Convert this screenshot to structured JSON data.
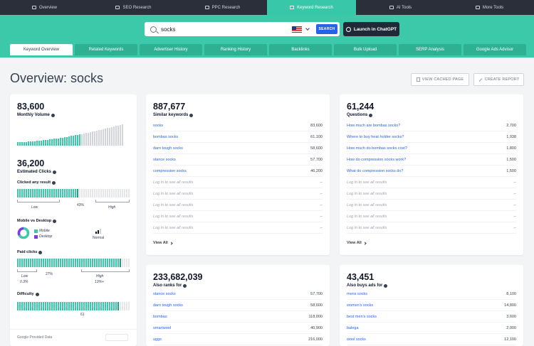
{
  "nav": [
    {
      "label": "Overview",
      "active": false
    },
    {
      "label": "SEO Research",
      "active": false
    },
    {
      "label": "PPC Research",
      "active": false
    },
    {
      "label": "Keyword Research",
      "active": true
    },
    {
      "label": "AI Tools",
      "active": false
    },
    {
      "label": "More Tools",
      "active": false
    }
  ],
  "search": {
    "value": "socks",
    "button": "SEARCH"
  },
  "chatgpt": {
    "label": "Launch in ChatGPT"
  },
  "tabs": [
    "Keyword Overview",
    "Related Keywords",
    "Advertiser History",
    "Ranking History",
    "Backlinks",
    "Bulk Upload",
    "SERP Analysis",
    "Google Ads Advisor"
  ],
  "page": {
    "title": "Overview: socks",
    "view_cached": "VIEW CACHED PAGE",
    "create_report": "CREATE REPORT"
  },
  "left": {
    "volume": "83,600",
    "volume_label": "Monthly Volume",
    "clicks": "36,200",
    "clicks_label": "Estimated Clicks",
    "clicked_any_label": "Clicked any result",
    "clicked_pct": "43%",
    "clicked_fraction": 0.43,
    "low": "Low",
    "high": "High",
    "mobile_label": "Mobile vs Desktop",
    "mobile": "Mobile",
    "desktop": "Desktop",
    "normal": "Normal",
    "paid_label": "Paid clicks",
    "paid_pct": "27%",
    "paid_fraction": 0.27,
    "paid_low": "Low",
    "paid_low_val": "0.3%",
    "paid_high": "High",
    "paid_high_val": "13%+",
    "difficulty_label": "Difficulty",
    "difficulty": "61",
    "difficulty_value": 61,
    "google_data": "Google Provided Data"
  },
  "similar": {
    "count": "887,677",
    "label": "Similar keywords",
    "rows": [
      {
        "k": "socks",
        "v": "83,600"
      },
      {
        "k": "bombas socks",
        "v": "61,100"
      },
      {
        "k": "darn tough socks",
        "v": "58,600"
      },
      {
        "k": "stance socks",
        "v": "57,700"
      },
      {
        "k": "compression socks",
        "v": "46,200"
      },
      {
        "k": "Log in to see all results",
        "v": "--"
      },
      {
        "k": "Log in to see all results",
        "v": "--"
      },
      {
        "k": "Log in to see all results",
        "v": "--"
      },
      {
        "k": "Log in to see all results",
        "v": "--"
      },
      {
        "k": "Log in to see all results",
        "v": "--"
      }
    ],
    "view_all": "View All"
  },
  "questions": {
    "count": "61,244",
    "label": "Questions",
    "rows": [
      {
        "k": "How much are bombas socks?",
        "v": "2,700"
      },
      {
        "k": "Where to buy heat holder socks?",
        "v": "1,938"
      },
      {
        "k": "How much do bombas socks cost?",
        "v": "1,800"
      },
      {
        "k": "How do compression socks work?",
        "v": "1,500"
      },
      {
        "k": "What do compression socks do?",
        "v": "1,500"
      },
      {
        "k": "Log in to see all results",
        "v": "--"
      },
      {
        "k": "Log in to see all results",
        "v": "--"
      },
      {
        "k": "Log in to see all results",
        "v": "--"
      },
      {
        "k": "Log in to see all results",
        "v": "--"
      },
      {
        "k": "Log in to see all results",
        "v": "--"
      }
    ],
    "view_all": "View All"
  },
  "also_ranks": {
    "count": "233,682,039",
    "label": "Also ranks for",
    "rows": [
      {
        "k": "stance socks",
        "v": "57,700"
      },
      {
        "k": "darn tough socks",
        "v": "58,600"
      },
      {
        "k": "bombas",
        "v": "118,000"
      },
      {
        "k": "smartwool",
        "v": "40,900"
      },
      {
        "k": "uggs",
        "v": "216,000"
      }
    ]
  },
  "also_buys": {
    "count": "43,451",
    "label": "Also buys ads for",
    "rows": [
      {
        "k": "mens socks",
        "v": "8,100"
      },
      {
        "k": "women's socks",
        "v": "14,800"
      },
      {
        "k": "best men's socks",
        "v": "3,600"
      },
      {
        "k": "balega",
        "v": "2,000"
      },
      {
        "k": "wool socks",
        "v": "12,100"
      }
    ]
  }
}
